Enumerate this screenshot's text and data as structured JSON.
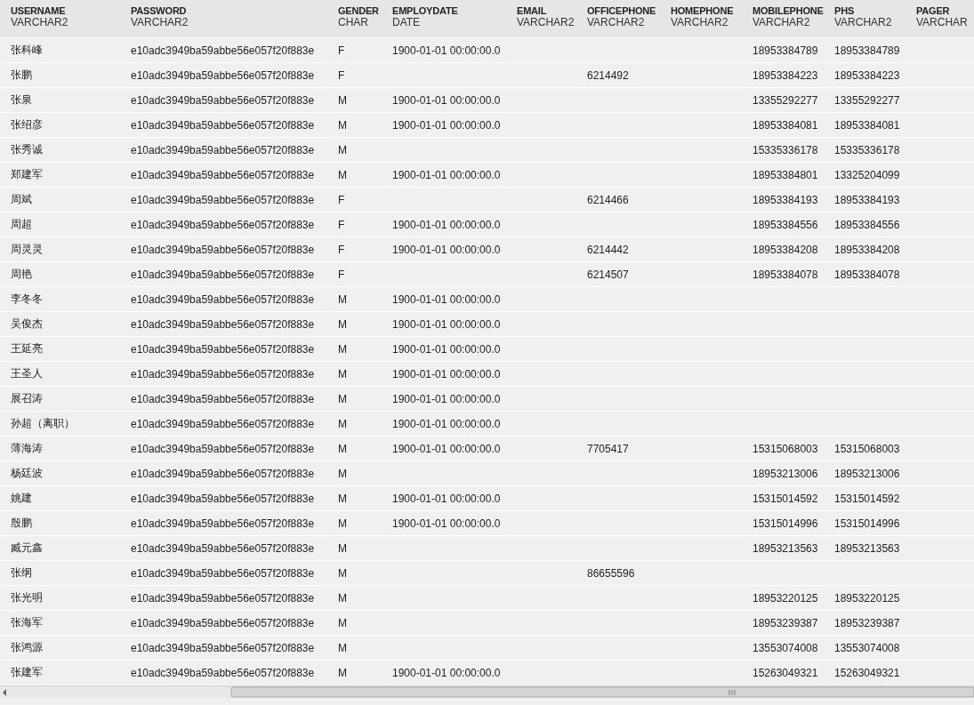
{
  "table": {
    "columns": [
      {
        "name": "USERNAME",
        "type": "VARCHAR2"
      },
      {
        "name": "PASSWORD",
        "type": "VARCHAR2"
      },
      {
        "name": "GENDER",
        "type": "CHAR"
      },
      {
        "name": "EMPLOYDATE",
        "type": "DATE"
      },
      {
        "name": "EMAIL",
        "type": "VARCHAR2"
      },
      {
        "name": "OFFICEPHONE",
        "type": "VARCHAR2"
      },
      {
        "name": "HOMEPHONE",
        "type": "VARCHAR2"
      },
      {
        "name": "MOBILEPHONE",
        "type": "VARCHAR2"
      },
      {
        "name": "PHS",
        "type": "VARCHAR2"
      },
      {
        "name": "PAGER",
        "type": "VARCHAR"
      }
    ],
    "rows": [
      {
        "username": "张科峰",
        "password": "e10adc3949ba59abbe56e057f20f883e",
        "gender": "F",
        "employdate": "1900-01-01 00:00:00.0",
        "mobilephone": "18953384789",
        "phs": "18953384789"
      },
      {
        "username": "张鹏",
        "password": "e10adc3949ba59abbe56e057f20f883e",
        "gender": "F",
        "officephone": "6214492",
        "mobilephone": "18953384223",
        "phs": "18953384223"
      },
      {
        "username": "张泉",
        "password": "e10adc3949ba59abbe56e057f20f883e",
        "gender": "M",
        "employdate": "1900-01-01 00:00:00.0",
        "mobilephone": "13355292277",
        "phs": "13355292277"
      },
      {
        "username": "张绍彦",
        "password": "e10adc3949ba59abbe56e057f20f883e",
        "gender": "M",
        "employdate": "1900-01-01 00:00:00.0",
        "mobilephone": "18953384081",
        "phs": "18953384081"
      },
      {
        "username": "张秀诚",
        "password": "e10adc3949ba59abbe56e057f20f883e",
        "gender": "M",
        "mobilephone": "15335336178",
        "phs": "15335336178"
      },
      {
        "username": "郑建军",
        "password": "e10adc3949ba59abbe56e057f20f883e",
        "gender": "M",
        "employdate": "1900-01-01 00:00:00.0",
        "mobilephone": "18953384801",
        "phs": "13325204099"
      },
      {
        "username": "周斌",
        "password": "e10adc3949ba59abbe56e057f20f883e",
        "gender": "F",
        "officephone": "6214466",
        "mobilephone": "18953384193",
        "phs": "18953384193"
      },
      {
        "username": "周超",
        "password": "e10adc3949ba59abbe56e057f20f883e",
        "gender": "F",
        "employdate": "1900-01-01 00:00:00.0",
        "mobilephone": "18953384556",
        "phs": "18953384556"
      },
      {
        "username": "周灵灵",
        "password": "e10adc3949ba59abbe56e057f20f883e",
        "gender": "F",
        "employdate": "1900-01-01 00:00:00.0",
        "officephone": "6214442",
        "mobilephone": "18953384208",
        "phs": "18953384208"
      },
      {
        "username": "周艳",
        "password": "e10adc3949ba59abbe56e057f20f883e",
        "gender": "F",
        "officephone": "6214507",
        "mobilephone": "18953384078",
        "phs": "18953384078"
      },
      {
        "username": "李冬冬",
        "password": "e10adc3949ba59abbe56e057f20f883e",
        "gender": "M",
        "employdate": "1900-01-01 00:00:00.0"
      },
      {
        "username": "吴俊杰",
        "password": "e10adc3949ba59abbe56e057f20f883e",
        "gender": "M",
        "employdate": "1900-01-01 00:00:00.0"
      },
      {
        "username": "王延亮",
        "password": "e10adc3949ba59abbe56e057f20f883e",
        "gender": "M",
        "employdate": "1900-01-01 00:00:00.0"
      },
      {
        "username": "王圣人",
        "password": "e10adc3949ba59abbe56e057f20f883e",
        "gender": "M",
        "employdate": "1900-01-01 00:00:00.0"
      },
      {
        "username": "展召涛",
        "password": "e10adc3949ba59abbe56e057f20f883e",
        "gender": "M",
        "employdate": "1900-01-01 00:00:00.0"
      },
      {
        "username": "孙超（离职）",
        "password": "e10adc3949ba59abbe56e057f20f883e",
        "gender": "M",
        "employdate": "1900-01-01 00:00:00.0"
      },
      {
        "username": "薄海涛",
        "password": "e10adc3949ba59abbe56e057f20f883e",
        "gender": "M",
        "employdate": "1900-01-01 00:00:00.0",
        "officephone": "7705417",
        "mobilephone": "15315068003",
        "phs": "15315068003"
      },
      {
        "username": "杨廷波",
        "password": "e10adc3949ba59abbe56e057f20f883e",
        "gender": "M",
        "mobilephone": "18953213006",
        "phs": "18953213006"
      },
      {
        "username": "姚建",
        "password": "e10adc3949ba59abbe56e057f20f883e",
        "gender": "M",
        "employdate": "1900-01-01 00:00:00.0",
        "mobilephone": "15315014592",
        "phs": "15315014592"
      },
      {
        "username": "殷鹏",
        "password": "e10adc3949ba59abbe56e057f20f883e",
        "gender": "M",
        "employdate": "1900-01-01 00:00:00.0",
        "mobilephone": "15315014996",
        "phs": "15315014996"
      },
      {
        "username": "臧元鑫",
        "password": "e10adc3949ba59abbe56e057f20f883e",
        "gender": "M",
        "mobilephone": "18953213563",
        "phs": "18953213563"
      },
      {
        "username": "张纲",
        "password": "e10adc3949ba59abbe56e057f20f883e",
        "gender": "M",
        "officephone": "86655596"
      },
      {
        "username": "张光明",
        "password": "e10adc3949ba59abbe56e057f20f883e",
        "gender": "M",
        "mobilephone": "18953220125",
        "phs": "18953220125"
      },
      {
        "username": "张海军",
        "password": "e10adc3949ba59abbe56e057f20f883e",
        "gender": "M",
        "mobilephone": "18953239387",
        "phs": "18953239387"
      },
      {
        "username": "张鸿源",
        "password": "e10adc3949ba59abbe56e057f20f883e",
        "gender": "M",
        "mobilephone": "13553074008",
        "phs": "13553074008"
      },
      {
        "username": "张建军",
        "password": "e10adc3949ba59abbe56e057f20f883e",
        "gender": "M",
        "employdate": "1900-01-01 00:00:00.0",
        "mobilephone": "15263049321",
        "phs": "15263049321"
      }
    ]
  }
}
